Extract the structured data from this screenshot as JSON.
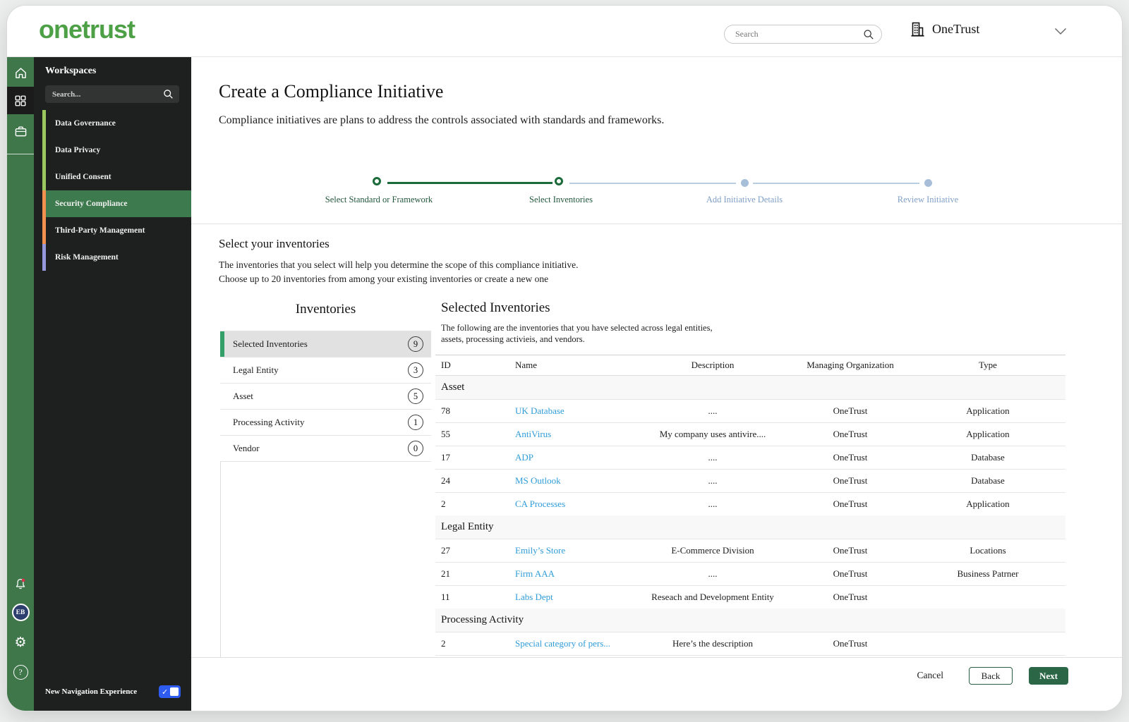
{
  "topbar": {
    "logo": "onetrust",
    "search_placeholder": "Search",
    "org_name": "OneTrust"
  },
  "sidebar": {
    "heading": "Workspaces",
    "search_placeholder": "Search...",
    "items": [
      {
        "label": "Data Governance",
        "strip_color": "#9bc75f",
        "active": false
      },
      {
        "label": "Data Privacy",
        "strip_color": "#9bc75f",
        "active": false
      },
      {
        "label": "Unified Consent",
        "strip_color": "#9bc75f",
        "active": false
      },
      {
        "label": "Security Compliance",
        "strip_color": "#f0914f",
        "active": true
      },
      {
        "label": "Third-Party Management",
        "strip_color": "#f0914f",
        "active": false
      },
      {
        "label": "Risk Management",
        "strip_color": "#9598da",
        "active": false
      }
    ],
    "avatar_initials": "EB",
    "new_nav_label": "New Navigation Experience"
  },
  "icons": {
    "gear": "⚙",
    "help": "?",
    "toggle_check": "✓"
  },
  "page": {
    "title": "Create a Compliance Initiative",
    "subtitle": "Compliance initiatives are plans to address the controls associated with standards and frameworks.",
    "steps": [
      {
        "label": "Select Standard or Framework",
        "state": "done"
      },
      {
        "label": "Select Inventories",
        "state": "current"
      },
      {
        "label": "Add Initiative Details",
        "state": "upcoming"
      },
      {
        "label": "Review Initiative",
        "state": "upcoming"
      }
    ],
    "intro": {
      "heading": "Select your inventories",
      "line1": "The inventories that you select will help you determine the scope of this compliance initiative.",
      "line2": "Choose up to 20 inventories from among your existing inventories or create a new one"
    },
    "inventories_panel": {
      "heading": "Inventories",
      "items": [
        {
          "label": "Selected Inventories",
          "count": "9",
          "active": true
        },
        {
          "label": "Legal Entity",
          "count": "3",
          "active": false
        },
        {
          "label": "Asset",
          "count": "5",
          "active": false
        },
        {
          "label": "Processing Activity",
          "count": "1",
          "active": false
        },
        {
          "label": "Vendor",
          "count": "0",
          "active": false
        }
      ]
    },
    "selected_panel": {
      "heading": "Selected Inventories",
      "desc_line1": "The following are the inventories that you have selected across legal entities,",
      "desc_line2": "assets, processing activieis, and vendors.",
      "columns": [
        "ID",
        "Name",
        "Description",
        "Managing Organization",
        "Type"
      ],
      "groups": [
        {
          "name": "Asset",
          "rows": [
            {
              "id": "78",
              "name": "UK Database",
              "description": "....",
              "org": "OneTrust",
              "type": "Application"
            },
            {
              "id": "55",
              "name": "AntiVirus",
              "description": "My company uses antivire....",
              "org": "OneTrust",
              "type": "Application"
            },
            {
              "id": "17",
              "name": "ADP",
              "description": "....",
              "org": "OneTrust",
              "type": "Database"
            },
            {
              "id": "24",
              "name": "MS Outlook",
              "description": "....",
              "org": "OneTrust",
              "type": "Database"
            },
            {
              "id": "2",
              "name": "CA Processes",
              "description": "....",
              "org": "OneTrust",
              "type": "Application"
            }
          ]
        },
        {
          "name": "Legal Entity",
          "rows": [
            {
              "id": "27",
              "name": "Emily’s Store",
              "description": "E-Commerce Division",
              "org": "OneTrust",
              "type": "Locations"
            },
            {
              "id": "21",
              "name": "Firm AAA",
              "description": "....",
              "org": "OneTrust",
              "type": "Business Patrner"
            },
            {
              "id": "11",
              "name": "Labs Dept",
              "description": "Reseach and Development Entity",
              "org": "OneTrust",
              "type": ""
            }
          ]
        },
        {
          "name": "Processing Activity",
          "rows": [
            {
              "id": "2",
              "name": "Special category of pers...",
              "description": "Here’s the description",
              "org": "OneTrust",
              "type": ""
            }
          ]
        }
      ]
    },
    "footer": {
      "cancel": "Cancel",
      "back": "Back",
      "next": "Next"
    }
  },
  "colors": {
    "brand_green": "#4da046",
    "rail_green": "#3f764a",
    "panel_dark": "#1e1f1f",
    "selected_item_green": "#3d7b4e",
    "active_bar_green": "#33a06a",
    "step_active_green": "#1b6a3a",
    "step_inactive_blue": "#a6bed8",
    "link_blue": "#2f9cd8",
    "next_button_green": "#2b6747",
    "toggle_blue": "#2e5bf0",
    "strip_green": "#9bc75f",
    "strip_orange": "#f0914f",
    "strip_purple": "#9598da"
  }
}
